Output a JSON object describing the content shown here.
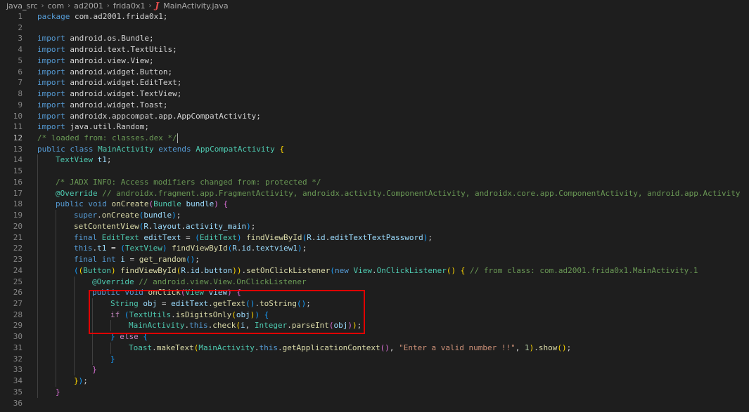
{
  "breadcrumb": {
    "items": [
      "java_src",
      "com",
      "ad2001",
      "frida0x1"
    ],
    "file": "MainActivity.java",
    "file_icon": "J"
  },
  "editor": {
    "active_line": 12,
    "lines": [
      {
        "n": "1",
        "indent": 0,
        "tokens": [
          [
            "kw",
            "package"
          ],
          [
            "pl",
            " com.ad2001.frida0x1;"
          ]
        ]
      },
      {
        "n": "2",
        "indent": 0,
        "tokens": []
      },
      {
        "n": "3",
        "indent": 0,
        "tokens": [
          [
            "kw",
            "import"
          ],
          [
            "pl",
            " android.os.Bundle;"
          ]
        ]
      },
      {
        "n": "4",
        "indent": 0,
        "tokens": [
          [
            "kw",
            "import"
          ],
          [
            "pl",
            " android.text.TextUtils;"
          ]
        ]
      },
      {
        "n": "5",
        "indent": 0,
        "tokens": [
          [
            "kw",
            "import"
          ],
          [
            "pl",
            " android.view.View;"
          ]
        ]
      },
      {
        "n": "6",
        "indent": 0,
        "tokens": [
          [
            "kw",
            "import"
          ],
          [
            "pl",
            " android.widget.Button;"
          ]
        ]
      },
      {
        "n": "7",
        "indent": 0,
        "tokens": [
          [
            "kw",
            "import"
          ],
          [
            "pl",
            " android.widget.EditText;"
          ]
        ]
      },
      {
        "n": "8",
        "indent": 0,
        "tokens": [
          [
            "kw",
            "import"
          ],
          [
            "pl",
            " android.widget.TextView;"
          ]
        ]
      },
      {
        "n": "9",
        "indent": 0,
        "tokens": [
          [
            "kw",
            "import"
          ],
          [
            "pl",
            " android.widget.Toast;"
          ]
        ]
      },
      {
        "n": "10",
        "indent": 0,
        "tokens": [
          [
            "kw",
            "import"
          ],
          [
            "pl",
            " androidx.appcompat.app.AppCompatActivity;"
          ]
        ]
      },
      {
        "n": "11",
        "indent": 0,
        "tokens": [
          [
            "kw",
            "import"
          ],
          [
            "pl",
            " java.util.Random;"
          ]
        ]
      },
      {
        "n": "12",
        "indent": 0,
        "tokens": [
          [
            "cm",
            "/* loaded from: classes.dex */"
          ]
        ],
        "cursor": true
      },
      {
        "n": "13",
        "indent": 0,
        "tokens": [
          [
            "kw",
            "public"
          ],
          [
            "pl",
            " "
          ],
          [
            "kw",
            "class"
          ],
          [
            "pl",
            " "
          ],
          [
            "ty",
            "MainActivity"
          ],
          [
            "pl",
            " "
          ],
          [
            "kw",
            "extends"
          ],
          [
            "pl",
            " "
          ],
          [
            "ty",
            "AppCompatActivity"
          ],
          [
            "pl",
            " "
          ],
          [
            "br1",
            "{"
          ]
        ]
      },
      {
        "n": "14",
        "indent": 1,
        "tokens": [
          [
            "ty",
            "TextView"
          ],
          [
            "pl",
            " "
          ],
          [
            "var",
            "t1"
          ],
          [
            "pl",
            ";"
          ]
        ]
      },
      {
        "n": "15",
        "indent": 1,
        "tokens": []
      },
      {
        "n": "16",
        "indent": 1,
        "tokens": [
          [
            "cm",
            "/* JADX INFO: Access modifiers changed from: protected */"
          ]
        ]
      },
      {
        "n": "17",
        "indent": 1,
        "tokens": [
          [
            "ty",
            "@Override"
          ],
          [
            "pl",
            " "
          ],
          [
            "cm",
            "// androidx.fragment.app.FragmentActivity, androidx.activity.ComponentActivity, androidx.core.app.ComponentActivity, android.app.Activity"
          ]
        ]
      },
      {
        "n": "18",
        "indent": 1,
        "tokens": [
          [
            "kw",
            "public"
          ],
          [
            "pl",
            " "
          ],
          [
            "kw",
            "void"
          ],
          [
            "pl",
            " "
          ],
          [
            "fn",
            "onCreate"
          ],
          [
            "br2",
            "("
          ],
          [
            "ty",
            "Bundle"
          ],
          [
            "pl",
            " "
          ],
          [
            "var",
            "bundle"
          ],
          [
            "br2",
            ")"
          ],
          [
            "pl",
            " "
          ],
          [
            "br2",
            "{"
          ]
        ]
      },
      {
        "n": "19",
        "indent": 2,
        "tokens": [
          [
            "kw",
            "super"
          ],
          [
            "pl",
            "."
          ],
          [
            "fn",
            "onCreate"
          ],
          [
            "br3",
            "("
          ],
          [
            "var",
            "bundle"
          ],
          [
            "br3",
            ")"
          ],
          [
            "pl",
            ";"
          ]
        ]
      },
      {
        "n": "20",
        "indent": 2,
        "tokens": [
          [
            "fn",
            "setContentView"
          ],
          [
            "br3",
            "("
          ],
          [
            "var",
            "R"
          ],
          [
            "pl",
            "."
          ],
          [
            "var",
            "layout"
          ],
          [
            "pl",
            "."
          ],
          [
            "var",
            "activity_main"
          ],
          [
            "br3",
            ")"
          ],
          [
            "pl",
            ";"
          ]
        ]
      },
      {
        "n": "21",
        "indent": 2,
        "tokens": [
          [
            "kw",
            "final"
          ],
          [
            "pl",
            " "
          ],
          [
            "ty",
            "EditText"
          ],
          [
            "pl",
            " "
          ],
          [
            "var",
            "editText"
          ],
          [
            "pl",
            " = "
          ],
          [
            "br3",
            "("
          ],
          [
            "ty",
            "EditText"
          ],
          [
            "br3",
            ")"
          ],
          [
            "pl",
            " "
          ],
          [
            "fn",
            "findViewById"
          ],
          [
            "br3",
            "("
          ],
          [
            "var",
            "R"
          ],
          [
            "pl",
            "."
          ],
          [
            "var",
            "id"
          ],
          [
            "pl",
            "."
          ],
          [
            "var",
            "editTextTextPassword"
          ],
          [
            "br3",
            ")"
          ],
          [
            "pl",
            ";"
          ]
        ]
      },
      {
        "n": "22",
        "indent": 2,
        "tokens": [
          [
            "kw",
            "this"
          ],
          [
            "pl",
            "."
          ],
          [
            "var",
            "t1"
          ],
          [
            "pl",
            " = "
          ],
          [
            "br3",
            "("
          ],
          [
            "ty",
            "TextView"
          ],
          [
            "br3",
            ")"
          ],
          [
            "pl",
            " "
          ],
          [
            "fn",
            "findViewById"
          ],
          [
            "br3",
            "("
          ],
          [
            "var",
            "R"
          ],
          [
            "pl",
            "."
          ],
          [
            "var",
            "id"
          ],
          [
            "pl",
            "."
          ],
          [
            "var",
            "textview1"
          ],
          [
            "br3",
            ")"
          ],
          [
            "pl",
            ";"
          ]
        ]
      },
      {
        "n": "23",
        "indent": 2,
        "tokens": [
          [
            "kw",
            "final"
          ],
          [
            "pl",
            " "
          ],
          [
            "kw",
            "int"
          ],
          [
            "pl",
            " "
          ],
          [
            "var",
            "i"
          ],
          [
            "pl",
            " = "
          ],
          [
            "fn",
            "get_random"
          ],
          [
            "br3",
            "()"
          ],
          [
            "pl",
            ";"
          ]
        ]
      },
      {
        "n": "24",
        "indent": 2,
        "tokens": [
          [
            "br3",
            "("
          ],
          [
            "br1",
            "("
          ],
          [
            "ty",
            "Button"
          ],
          [
            "br1",
            ")"
          ],
          [
            "pl",
            " "
          ],
          [
            "fn",
            "findViewById"
          ],
          [
            "br1",
            "("
          ],
          [
            "var",
            "R"
          ],
          [
            "pl",
            "."
          ],
          [
            "var",
            "id"
          ],
          [
            "pl",
            "."
          ],
          [
            "var",
            "button"
          ],
          [
            "br1",
            "))"
          ],
          [
            "pl",
            "."
          ],
          [
            "fn",
            "setOnClickListener"
          ],
          [
            "br3",
            "("
          ],
          [
            "kw",
            "new"
          ],
          [
            "pl",
            " "
          ],
          [
            "ty",
            "View"
          ],
          [
            "pl",
            "."
          ],
          [
            "ty",
            "OnClickListener"
          ],
          [
            "br1",
            "()"
          ],
          [
            "pl",
            " "
          ],
          [
            "br1",
            "{"
          ],
          [
            "pl",
            " "
          ],
          [
            "cm",
            "// from class: com.ad2001.frida0x1.MainActivity.1"
          ]
        ]
      },
      {
        "n": "25",
        "indent": 3,
        "tokens": [
          [
            "ty",
            "@Override"
          ],
          [
            "pl",
            " "
          ],
          [
            "cm",
            "// android.view.View.OnClickListener"
          ]
        ]
      },
      {
        "n": "26",
        "indent": 3,
        "tokens": [
          [
            "kw",
            "public"
          ],
          [
            "pl",
            " "
          ],
          [
            "kw",
            "void"
          ],
          [
            "pl",
            " "
          ],
          [
            "fn",
            "onClick"
          ],
          [
            "br2",
            "("
          ],
          [
            "ty",
            "View"
          ],
          [
            "pl",
            " "
          ],
          [
            "var",
            "view"
          ],
          [
            "br2",
            ")"
          ],
          [
            "pl",
            " "
          ],
          [
            "br2",
            "{"
          ]
        ]
      },
      {
        "n": "27",
        "indent": 4,
        "tokens": [
          [
            "ty",
            "String"
          ],
          [
            "pl",
            " "
          ],
          [
            "var",
            "obj"
          ],
          [
            "pl",
            " = "
          ],
          [
            "var",
            "editText"
          ],
          [
            "pl",
            "."
          ],
          [
            "fn",
            "getText"
          ],
          [
            "br3",
            "()"
          ],
          [
            "pl",
            "."
          ],
          [
            "fn",
            "toString"
          ],
          [
            "br3",
            "()"
          ],
          [
            "pl",
            ";"
          ]
        ]
      },
      {
        "n": "28",
        "indent": 4,
        "tokens": [
          [
            "ctl",
            "if"
          ],
          [
            "pl",
            " "
          ],
          [
            "br3",
            "("
          ],
          [
            "ty",
            "TextUtils"
          ],
          [
            "pl",
            "."
          ],
          [
            "fn",
            "isDigitsOnly"
          ],
          [
            "br1",
            "("
          ],
          [
            "var",
            "obj"
          ],
          [
            "br1",
            ")"
          ],
          [
            "br3",
            ")"
          ],
          [
            "pl",
            " "
          ],
          [
            "br3",
            "{"
          ]
        ]
      },
      {
        "n": "29",
        "indent": 5,
        "tokens": [
          [
            "ty",
            "MainActivity"
          ],
          [
            "pl",
            "."
          ],
          [
            "kw",
            "this"
          ],
          [
            "pl",
            "."
          ],
          [
            "fn",
            "check"
          ],
          [
            "br1",
            "("
          ],
          [
            "var",
            "i"
          ],
          [
            "pl",
            ", "
          ],
          [
            "ty",
            "Integer"
          ],
          [
            "pl",
            "."
          ],
          [
            "fn",
            "parseInt"
          ],
          [
            "br2",
            "("
          ],
          [
            "var",
            "obj"
          ],
          [
            "br2",
            ")"
          ],
          [
            "br1",
            ")"
          ],
          [
            "pl",
            ";"
          ]
        ]
      },
      {
        "n": "30",
        "indent": 4,
        "tokens": [
          [
            "br3",
            "}"
          ],
          [
            "pl",
            " "
          ],
          [
            "ctl",
            "else"
          ],
          [
            "pl",
            " "
          ],
          [
            "br3",
            "{"
          ]
        ]
      },
      {
        "n": "31",
        "indent": 5,
        "tokens": [
          [
            "ty",
            "Toast"
          ],
          [
            "pl",
            "."
          ],
          [
            "fn",
            "makeText"
          ],
          [
            "br1",
            "("
          ],
          [
            "ty",
            "MainActivity"
          ],
          [
            "pl",
            "."
          ],
          [
            "kw",
            "this"
          ],
          [
            "pl",
            "."
          ],
          [
            "fn",
            "getApplicationContext"
          ],
          [
            "br2",
            "()"
          ],
          [
            "pl",
            ", "
          ],
          [
            "st",
            "\"Enter a valid number !!\""
          ],
          [
            "pl",
            ", "
          ],
          [
            "nu",
            "1"
          ],
          [
            "br1",
            ")"
          ],
          [
            "pl",
            "."
          ],
          [
            "fn",
            "show"
          ],
          [
            "br1",
            "()"
          ],
          [
            "pl",
            ";"
          ]
        ]
      },
      {
        "n": "32",
        "indent": 4,
        "tokens": [
          [
            "br3",
            "}"
          ]
        ]
      },
      {
        "n": "33",
        "indent": 3,
        "tokens": [
          [
            "br2",
            "}"
          ]
        ]
      },
      {
        "n": "34",
        "indent": 2,
        "tokens": [
          [
            "br1",
            "}"
          ],
          [
            "br3",
            ")"
          ],
          [
            "pl",
            ";"
          ]
        ]
      },
      {
        "n": "35",
        "indent": 1,
        "tokens": [
          [
            "br2",
            "}"
          ]
        ]
      },
      {
        "n": "36",
        "indent": 0,
        "tokens": []
      }
    ]
  },
  "colors": {
    "background": "#1e1e1e",
    "keyword": "#569cd6",
    "type": "#4ec9b0",
    "function": "#dcdcaa",
    "variable": "#9cdcfe",
    "comment": "#6a9955",
    "string": "#ce9178",
    "highlight_box": "#e00000"
  }
}
